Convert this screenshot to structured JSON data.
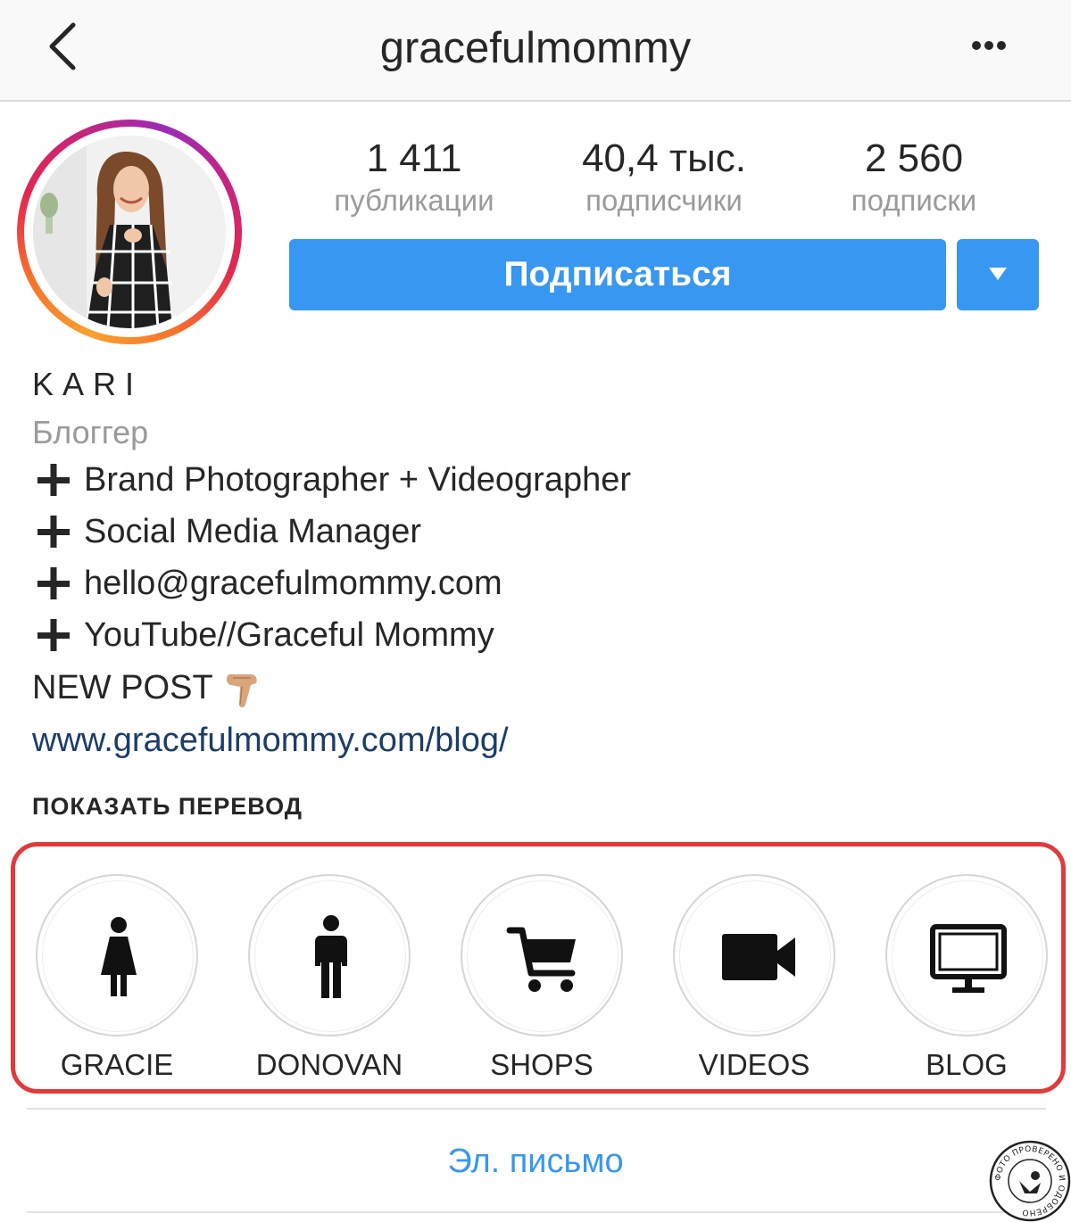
{
  "header": {
    "username": "gracefulmommy"
  },
  "stats": [
    {
      "count": "1 411",
      "label": "публикации"
    },
    {
      "count": "40,4 тыс.",
      "label": "подписчики"
    },
    {
      "count": "2 560",
      "label": "подписки"
    }
  ],
  "actions": {
    "follow_label": "Подписаться"
  },
  "bio": {
    "name": "KARI",
    "category": "Блоггер",
    "lines": [
      "Brand Photographer + Videographer",
      "Social Media Manager",
      "hello@gracefulmommy.com",
      "YouTube//Graceful Mommy"
    ],
    "new_post": "NEW POST",
    "link": "www.gracefulmommy.com/blog/",
    "translate": "ПОКАЗАТЬ ПЕРЕВОД"
  },
  "highlights": [
    {
      "label": "GRACIE",
      "icon": "woman-icon"
    },
    {
      "label": "DONOVAN",
      "icon": "man-icon"
    },
    {
      "label": "SHOPS",
      "icon": "cart-icon"
    },
    {
      "label": "VIDEOS",
      "icon": "video-camera-icon"
    },
    {
      "label": "BLOG",
      "icon": "monitor-icon"
    }
  ],
  "contact": {
    "email_label": "Эл. письмо"
  },
  "stamp": {
    "text": "ФОТО ПРОВЕРЕНО И ОДОБРЕНО"
  },
  "colors": {
    "accent": "#3897f0",
    "highlight_border": "#e03a3a",
    "link": "#1b3d6a"
  }
}
